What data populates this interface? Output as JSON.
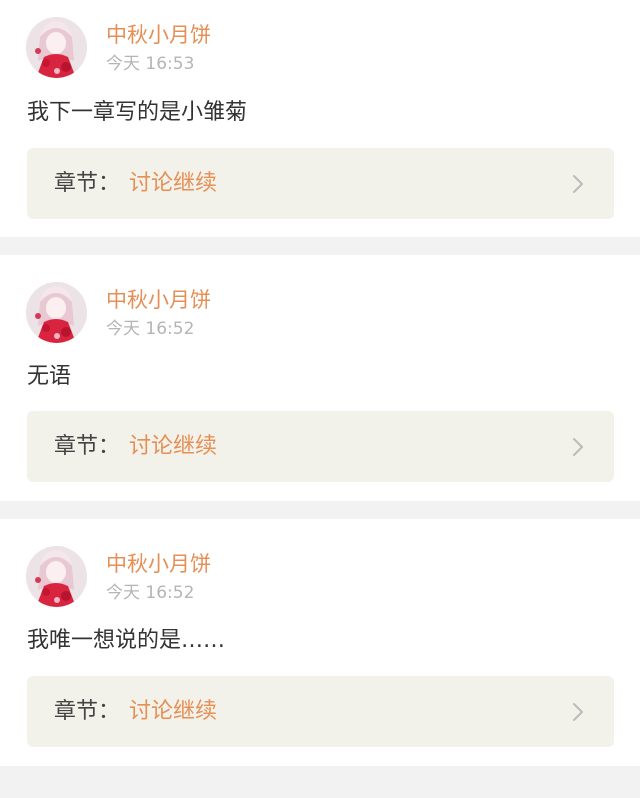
{
  "posts": [
    {
      "username": "中秋小月饼",
      "time": "今天 16:53",
      "message": "我下一章写的是小雏菊",
      "chapter_prefix": "章节：",
      "chapter_title": "讨论继续",
      "avatar_icon": "anime-avatar-icon",
      "chevron_icon": "chevron-right-icon"
    },
    {
      "username": "中秋小月饼",
      "time": "今天 16:52",
      "message": "无语",
      "chapter_prefix": "章节：",
      "chapter_title": "讨论继续",
      "avatar_icon": "anime-avatar-icon",
      "chevron_icon": "chevron-right-icon"
    },
    {
      "username": "中秋小月饼",
      "time": "今天 16:52",
      "message": "我唯一想说的是……",
      "chapter_prefix": "章节：",
      "chapter_title": "讨论继续",
      "avatar_icon": "anime-avatar-icon",
      "chevron_icon": "chevron-right-icon"
    }
  ],
  "colors": {
    "accent": "#e58f55",
    "timestamp": "#b5b5b5",
    "link_bg": "#f3f2ea",
    "separator": "#f2f2f2"
  }
}
